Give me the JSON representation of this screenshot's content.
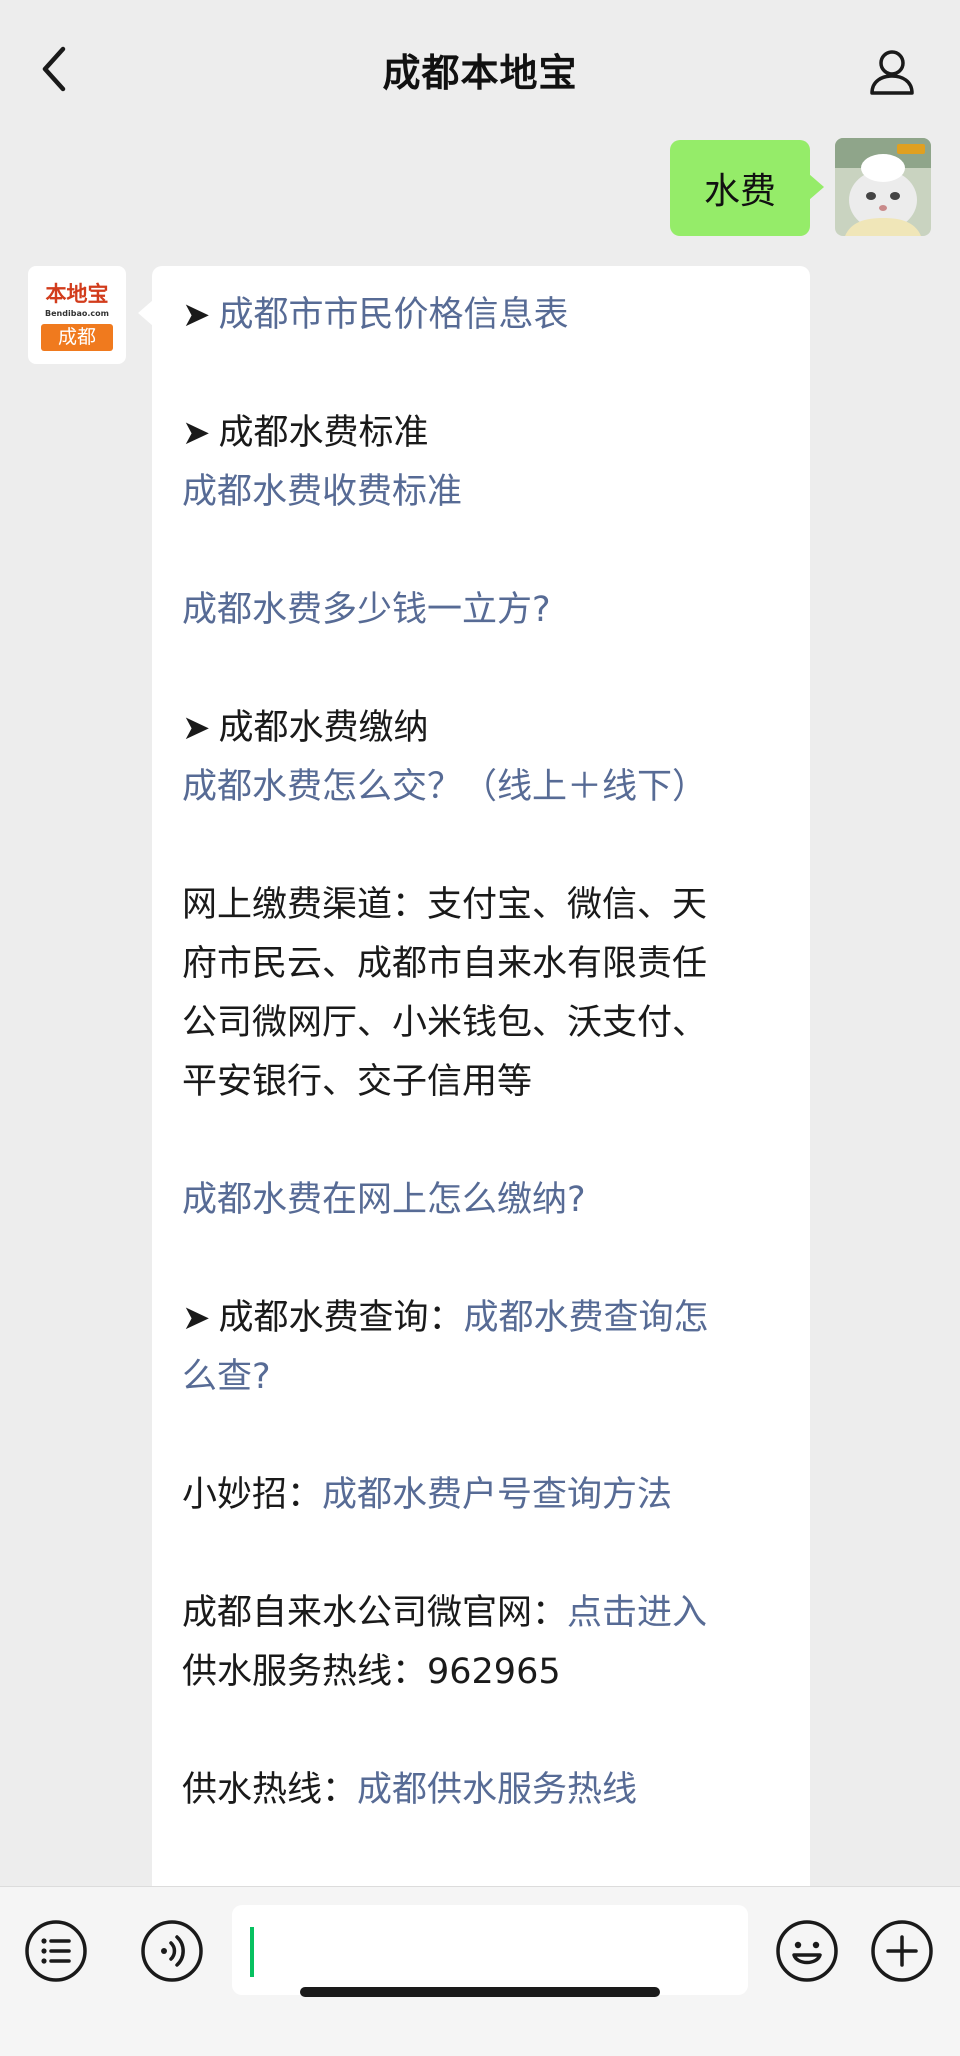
{
  "nav": {
    "title": "成都本地宝"
  },
  "outgoing": {
    "text": "水费"
  },
  "bot": {
    "logo_top": "本地宝",
    "logo_url": "Bendibao.com",
    "logo_city": "成都"
  },
  "message": {
    "arrow": "➤",
    "line1_link": "成都市市民价格信息表",
    "section1_title": "成都水费标准",
    "section1_link": "成都水费收费标准",
    "link_how_much": "成都水费多少钱一立方?",
    "section2_title": "成都水费缴纳",
    "section2_link": "成都水费怎么交？（线上＋线下）",
    "channels_line1": "网上缴费渠道：支付宝、微信、天",
    "channels_line2": "府市民云、成都市自来水有限责任",
    "channels_line3": "公司微网厅、小米钱包、沃支付、",
    "channels_line4": "平安银行、交子信用等",
    "link_online_pay": "成都水费在网上怎么缴纳?",
    "query_title": "成都水费查询：",
    "query_link_part1": "成都水费查询怎",
    "query_link_part2": "么查?",
    "tip_label": "小妙招：",
    "tip_link": "成都水费户号查询方法",
    "site_label": "成都自来水公司微官网：",
    "site_link": "点击进入",
    "hotline_line": "供水服务热线：962965",
    "hotline_label": "供水热线：",
    "hotline_link": "成都供水服务热线"
  },
  "input": {
    "placeholder": ""
  },
  "icons": {
    "back": "chevron-left-icon",
    "user": "user-icon",
    "menu": "list-icon",
    "voice": "voice-icon",
    "emoji": "emoji-icon",
    "plus": "plus-icon"
  },
  "colors": {
    "link": "#576b95",
    "bubble_out": "#95ec69",
    "background": "#ededed"
  }
}
